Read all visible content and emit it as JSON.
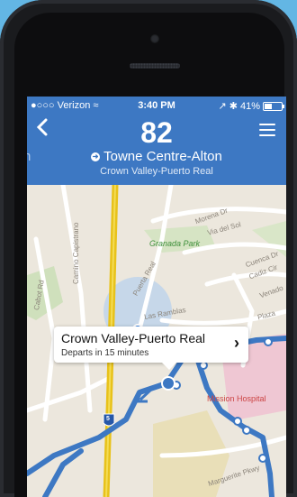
{
  "status_bar": {
    "carrier": "●○○○ Verizon",
    "time": "3:40 PM",
    "battery": "41%"
  },
  "header": {
    "route_number": "82",
    "destination": "Towne Centre-Alton",
    "stop_name": "Crown Valley-Puerto Real",
    "edge_letter": "n"
  },
  "map": {
    "labels": {
      "morena": "Morena Dr",
      "via_del_sol": "Via del Sol",
      "granada_park": "Granada Park",
      "camino_capistrano": "Camino Capistrano",
      "cuenca": "Cuenca Dr",
      "cadiz": "Cadiz Cir",
      "venado": "Venado",
      "cabot": "Cabot Rd",
      "puerta_real": "Puerta Real",
      "las_ramblas": "Las Ramblas",
      "plaza": "Plaza",
      "mission_hospital": "Mission Hospital",
      "marguerite": "Marguerite Pkwy",
      "interstate": "5"
    }
  },
  "callout": {
    "title": "Crown Valley-Puerto Real",
    "subtitle": "Departs in 15 minutes"
  },
  "colors": {
    "header": "#3d78c3",
    "route_line": "#3d78c3",
    "highway": "#e8c21a",
    "background": "#63b6e4"
  }
}
